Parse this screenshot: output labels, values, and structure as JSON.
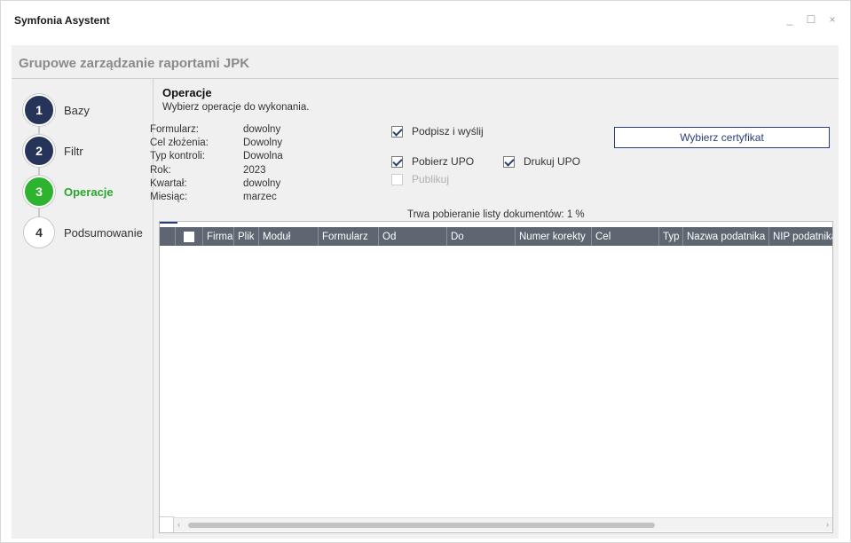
{
  "window": {
    "title": "Symfonia Asystent",
    "controls": {
      "minimize": "_",
      "maximize": "☐",
      "close": "×"
    }
  },
  "page": {
    "title": "Grupowe zarządzanie raportami JPK"
  },
  "steps": [
    {
      "number": "1",
      "label": "Bazy",
      "state": "done"
    },
    {
      "number": "2",
      "label": "Filtr",
      "state": "done"
    },
    {
      "number": "3",
      "label": "Operacje",
      "state": "active"
    },
    {
      "number": "4",
      "label": "Podsumowanie",
      "state": "todo"
    }
  ],
  "operations": {
    "title": "Operacje",
    "subtitle": "Wybierz operacje do wykonania.",
    "params": [
      {
        "key": "Formularz:",
        "value": "dowolny"
      },
      {
        "key": "Cel złożenia:",
        "value": "Dowolny"
      },
      {
        "key": "Typ kontroli:",
        "value": "Dowolna"
      },
      {
        "key": "Rok:",
        "value": "2023"
      },
      {
        "key": "Kwartał:",
        "value": "dowolny"
      },
      {
        "key": "Miesiąc:",
        "value": "marzec"
      }
    ],
    "sign_and_send": {
      "label": "Podpisz i wyślij",
      "checked": true
    },
    "get_upo": {
      "label": "Pobierz UPO",
      "checked": true
    },
    "print_upo": {
      "label": "Drukuj UPO",
      "checked": true
    },
    "publish": {
      "label": "Publikuj",
      "checked": false,
      "disabled": true
    },
    "choose_cert_label": "Wybierz certyfikat",
    "progress_text": "Trwa pobieranie listy dokumentów: 1 %"
  },
  "grid": {
    "columns": [
      "Firma",
      "Plik",
      "Moduł",
      "Formularz",
      "Od",
      "Do",
      "Numer korekty",
      "Cel",
      "Typ",
      "Nazwa podatnika",
      "NIP podatnika"
    ]
  },
  "colors": {
    "step_done": "#27345a",
    "step_active": "#2db32d",
    "accent": "#2a3f7a",
    "grid_header": "#5e6672"
  }
}
